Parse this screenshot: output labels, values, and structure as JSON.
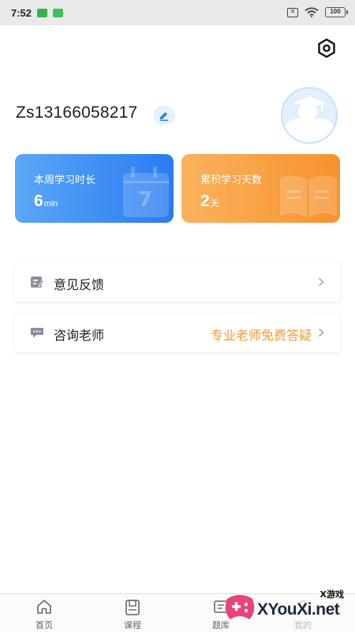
{
  "status_bar": {
    "time": "7:52",
    "battery": "100"
  },
  "profile": {
    "username": "Zs13166058217"
  },
  "stats": {
    "weekly": {
      "label": "本周学习时长",
      "value": "6",
      "unit": "min"
    },
    "total": {
      "label": "累积学习天数",
      "value": "2",
      "unit": "天"
    }
  },
  "menu": {
    "feedback": {
      "label": "意见反馈"
    },
    "consult": {
      "label": "咨询老师",
      "hint": "专业老师免费答疑"
    }
  },
  "tabbar": {
    "items": [
      {
        "label": "首页",
        "icon": "home-icon"
      },
      {
        "label": "课程",
        "icon": "book-icon"
      },
      {
        "label": "题库",
        "icon": "question-bank-icon"
      },
      {
        "label": "我的",
        "icon": "profile-icon"
      }
    ]
  },
  "watermark": {
    "small": "X游戏",
    "text": "XYouXi.net"
  },
  "colors": {
    "accent_blue": "#2a7bf2",
    "accent_orange": "#f7922e",
    "hint_orange": "#f39a36"
  }
}
